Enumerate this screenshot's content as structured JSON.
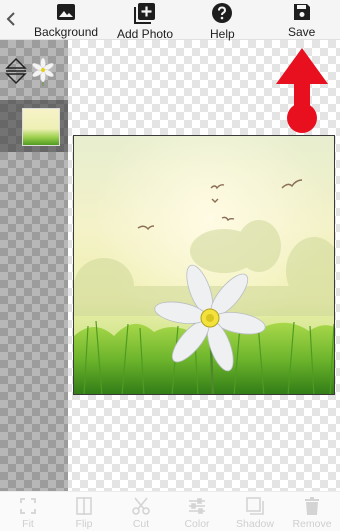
{
  "toolbar": {
    "back_icon": "chevron-left-icon",
    "items": [
      {
        "label": "Background",
        "icon": "image-icon"
      },
      {
        "label": "Add Photo",
        "icon": "add-photo-icon"
      },
      {
        "label": "Help",
        "icon": "help-icon"
      },
      {
        "label": "Save",
        "icon": "save-icon"
      }
    ]
  },
  "layers": {
    "reorder_icon": "reorder-arrows-icon",
    "items": [
      {
        "type": "flower-cutout",
        "selected": false
      },
      {
        "type": "background-image",
        "selected": true
      }
    ]
  },
  "annotation": {
    "color": "#e8101f",
    "points_to": "Save"
  },
  "bottombar": {
    "items": [
      {
        "label": "Fit",
        "icon": "fit-icon",
        "enabled": false
      },
      {
        "label": "Flip",
        "icon": "flip-icon",
        "enabled": false
      },
      {
        "label": "Cut",
        "icon": "scissors-icon",
        "enabled": false
      },
      {
        "label": "Color",
        "icon": "color-adjust-icon",
        "enabled": false
      },
      {
        "label": "Shadow",
        "icon": "shadow-icon",
        "enabled": false
      },
      {
        "label": "Remove",
        "icon": "trash-icon",
        "enabled": false
      }
    ]
  }
}
